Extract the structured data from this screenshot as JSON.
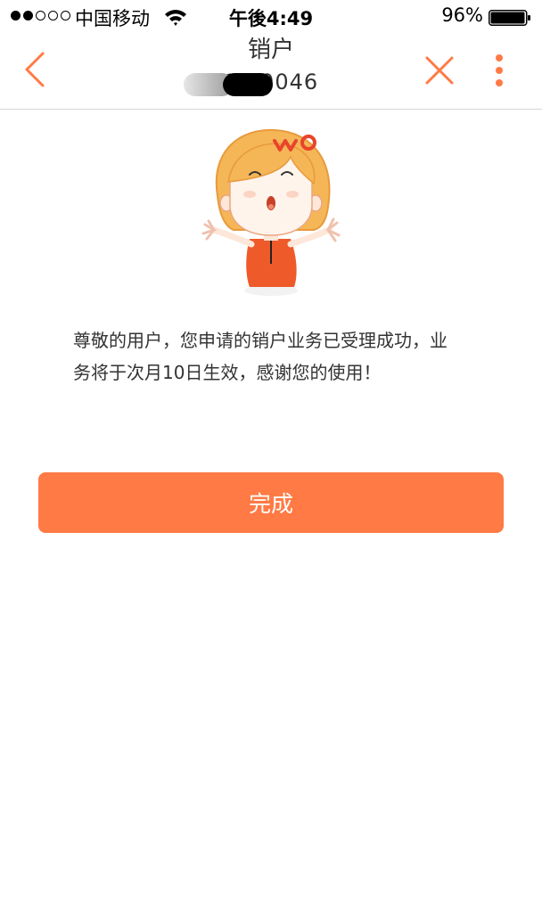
{
  "status_bar": {
    "signal_bars": 2,
    "signal_total": 5,
    "carrier": "中国移动",
    "wifi_icon": "wifi-icon",
    "time": "午後4:49",
    "battery_percent": "96%",
    "battery_level": 0.96
  },
  "nav": {
    "back_icon": "chevron-left-icon",
    "title": "销户",
    "phone_number": "17  0046",
    "close_icon": "close-icon",
    "more_icon": "more-vertical-icon",
    "accent_color": "#ff7a45"
  },
  "content": {
    "mascot_icon": "wo-mascot-girl",
    "message": "尊敬的用户，您申请的销户业务已受理成功，业务将于次月10日生效，感谢您的使用！",
    "done_label": "完成",
    "button_color": "#ff7a45"
  }
}
